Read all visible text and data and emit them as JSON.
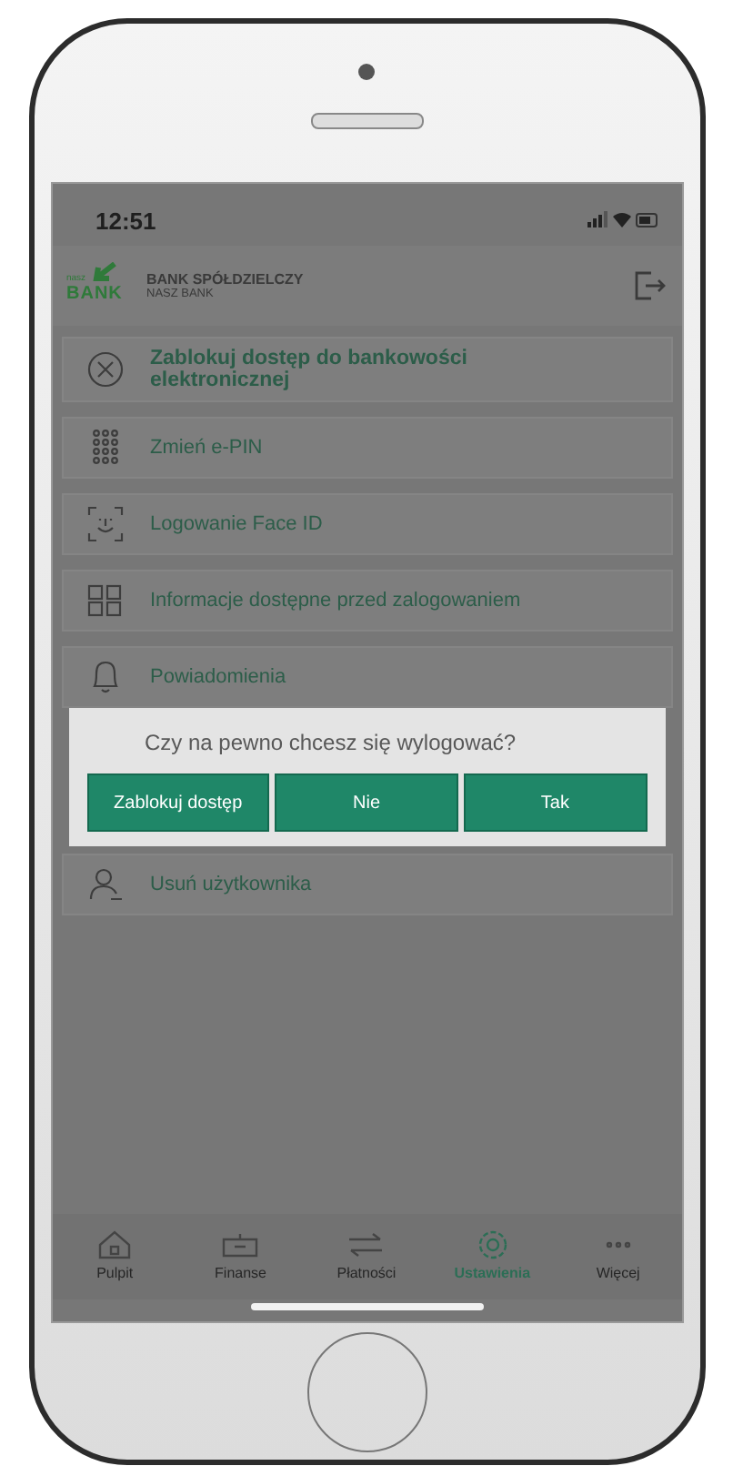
{
  "status_bar": {
    "time": "12:51"
  },
  "header": {
    "logo_small": "nasz",
    "logo_text": "BANK",
    "bank_name": "BANK SPÓŁDZIELCZY",
    "bank_subtitle": "NASZ BANK"
  },
  "menu": [
    {
      "label": "Zablokuj dostęp do bankowości elektronicznej",
      "kind": "primary"
    },
    {
      "label": "Zmień e-PIN",
      "kind": "regular"
    },
    {
      "label": "Logowanie Face ID",
      "kind": "regular"
    },
    {
      "label": "Informacje dostępne przed zalogowaniem",
      "kind": "regular"
    },
    {
      "label": "Powiadomienia",
      "kind": "regular"
    }
  ],
  "dialog": {
    "message": "Czy na pewno chcesz się wylogować?",
    "buttons": [
      "Zablokuj dostęp",
      "Nie",
      "Tak"
    ]
  },
  "menu_after": [
    {
      "label": "Usuń użytkownika"
    }
  ],
  "tab_bar": [
    {
      "label": "Pulpit",
      "selected": false
    },
    {
      "label": "Finanse",
      "selected": false
    },
    {
      "label": "Płatności",
      "selected": false
    },
    {
      "label": "Ustawienia",
      "selected": true
    },
    {
      "label": "Więcej",
      "selected": false
    }
  ]
}
